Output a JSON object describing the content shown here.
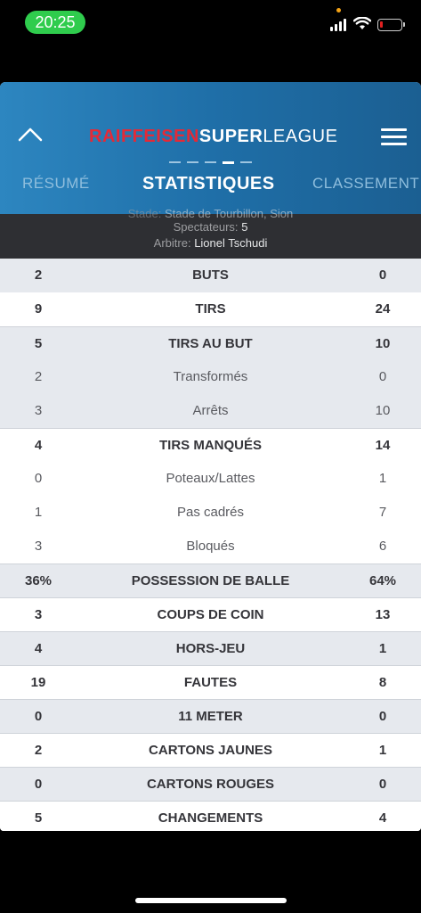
{
  "status_bar": {
    "time": "20:25"
  },
  "header": {
    "logo_part1": "RAIFFEISEN",
    "logo_part2": "SUPER",
    "logo_part3": "LEAGUE",
    "tabs": [
      "RÉSUMÉ",
      "STATISTIQUES",
      "CLASSEMENT"
    ],
    "active_tab": "STATISTIQUES"
  },
  "match_info": {
    "stade_label": "Stade:",
    "stade_value": "Stade de Tourbillon, Sion",
    "spectateurs_label": "Spectateurs:",
    "spectateurs_value": "5",
    "arbitre_label": "Arbitre:",
    "arbitre_value": "Lionel Tschudi"
  },
  "stats": [
    {
      "home": "2",
      "label": "BUTS",
      "away": "0",
      "style": "main"
    },
    {
      "home": "9",
      "label": "TIRS",
      "away": "24",
      "style": "main"
    },
    {
      "home": "5",
      "label": "TIRS AU BUT",
      "away": "10",
      "style": "main"
    },
    {
      "home": "2",
      "label": "Transformés",
      "away": "0",
      "style": "sub"
    },
    {
      "home": "3",
      "label": "Arrêts",
      "away": "10",
      "style": "sub"
    },
    {
      "home": "4",
      "label": "TIRS MANQUÉS",
      "away": "14",
      "style": "main"
    },
    {
      "home": "0",
      "label": "Poteaux/Lattes",
      "away": "1",
      "style": "sub"
    },
    {
      "home": "1",
      "label": "Pas cadrés",
      "away": "7",
      "style": "sub"
    },
    {
      "home": "3",
      "label": "Bloqués",
      "away": "6",
      "style": "sub"
    },
    {
      "home": "36%",
      "label": "POSSESSION DE BALLE",
      "away": "64%",
      "style": "main"
    },
    {
      "home": "3",
      "label": "COUPS DE COIN",
      "away": "13",
      "style": "main"
    },
    {
      "home": "4",
      "label": "HORS-JEU",
      "away": "1",
      "style": "main"
    },
    {
      "home": "19",
      "label": "FAUTES",
      "away": "8",
      "style": "main"
    },
    {
      "home": "0",
      "label": "11 METER",
      "away": "0",
      "style": "main"
    },
    {
      "home": "2",
      "label": "CARTONS JAUNES",
      "away": "1",
      "style": "main"
    },
    {
      "home": "0",
      "label": "CARTONS ROUGES",
      "away": "0",
      "style": "main"
    },
    {
      "home": "5",
      "label": "CHANGEMENTS",
      "away": "4",
      "style": "main"
    }
  ],
  "colors": {
    "header_blue": "#1f6fa8",
    "logo_red": "#e32a37",
    "status_green": "#2fcc4d",
    "info_bg": "#2e2f33",
    "row_grey": "#e6e9ee"
  }
}
